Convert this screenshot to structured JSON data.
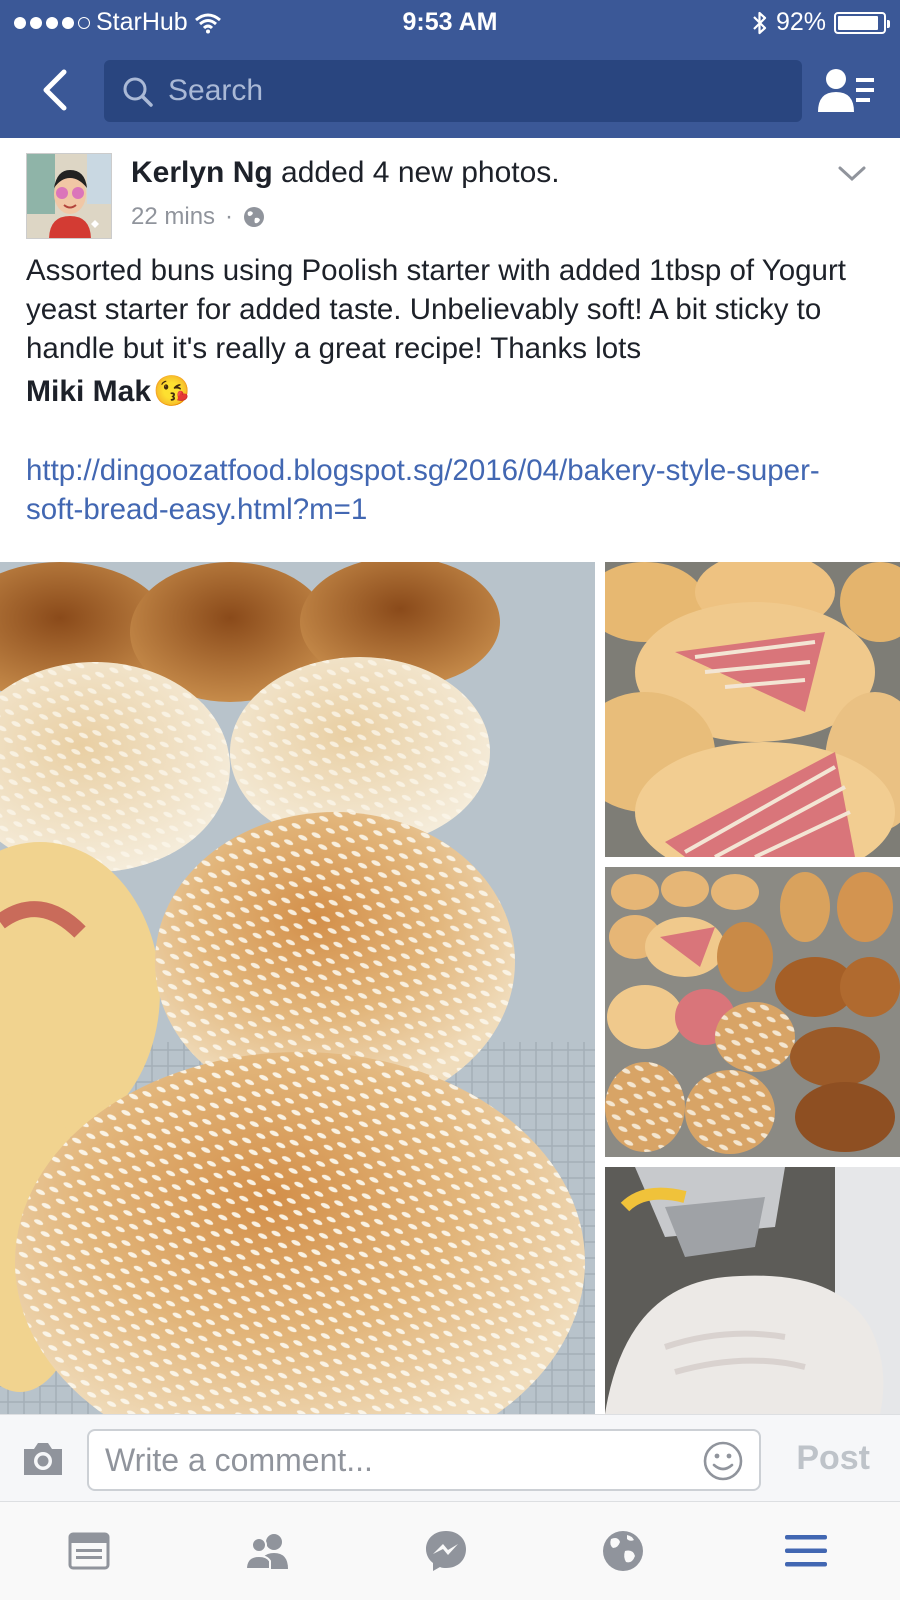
{
  "status_bar": {
    "carrier": "StarHub",
    "time": "9:53 AM",
    "battery": "92%",
    "battery_level": 0.92,
    "signal_bars_filled": 4,
    "icons": [
      "wifi-icon",
      "bluetooth-icon",
      "battery-icon"
    ]
  },
  "nav": {
    "back_icon": "chevron-left-icon",
    "search_placeholder": "Search",
    "friends_icon": "friend-requests-icon"
  },
  "post": {
    "author": "Kerlyn Ng",
    "action": "added 4 new photos.",
    "time": "22 mins",
    "separator": "·",
    "privacy_icon": "globe-icon",
    "text": "Assorted buns using Poolish starter with added 1tbsp of Yogurt yeast starter for added taste. Unbelievably soft! A bit sticky to handle but it's really a great recipe! Thanks lots",
    "mention": "Miki Mak",
    "emoji": "😘",
    "link": "http://dingoozatfood.blogspot.sg/2016/04/bakery-style-super-soft-bread-easy.html?m=1",
    "photo_count": 4
  },
  "comment_bar": {
    "placeholder": "Write a comment...",
    "post_label": "Post",
    "icons": [
      "camera-icon",
      "smiley-icon"
    ]
  },
  "tab_bar": {
    "tabs": [
      "news-feed-tab",
      "friends-tab",
      "messenger-tab",
      "notifications-tab",
      "menu-tab"
    ],
    "active": "menu-tab"
  },
  "colors": {
    "brand_blue": "#3b5897",
    "search_bg": "#29457f",
    "link_blue": "#4267b2",
    "meta_gray": "#90949c",
    "active_tab": "#4267b2"
  }
}
